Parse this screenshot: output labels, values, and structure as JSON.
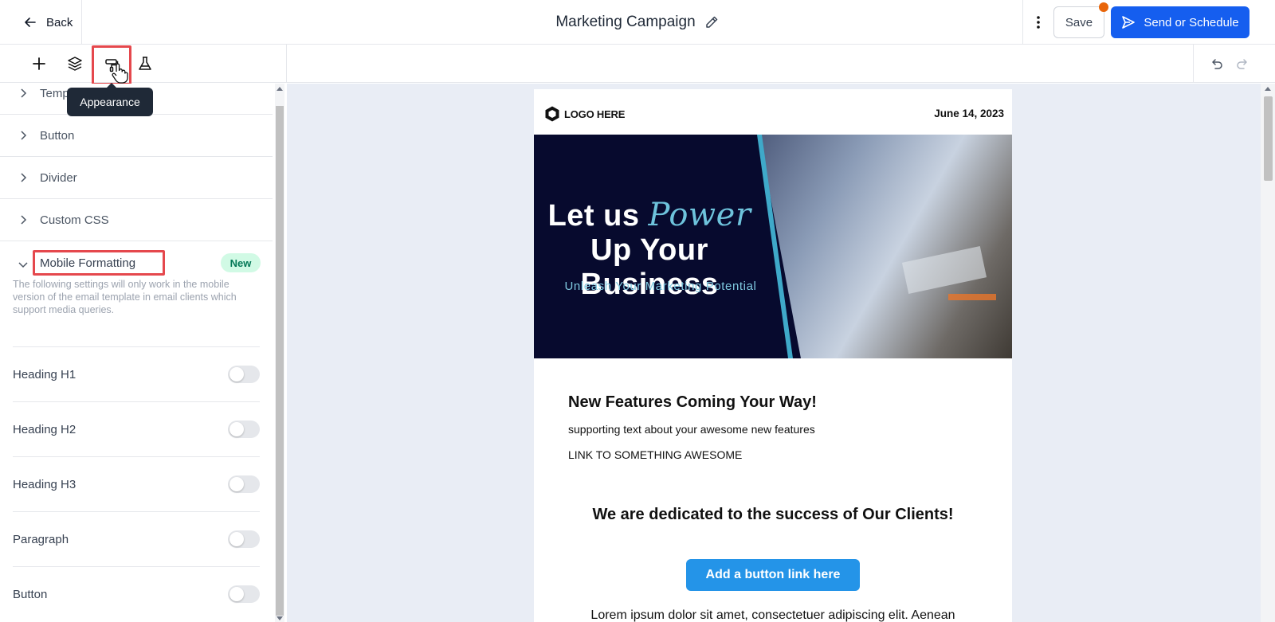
{
  "header": {
    "back_label": "Back",
    "title": "Marketing Campaign",
    "save_label": "Save",
    "send_label": "Send or Schedule",
    "colors": {
      "primary": "#155eef",
      "notification_dot": "#e8650a",
      "highlight": "#e5484d"
    }
  },
  "toolbar": {
    "tools": [
      "add-icon",
      "layers-icon",
      "appearance-icon",
      "flask-icon"
    ],
    "tooltip": "Appearance"
  },
  "panel": {
    "sections": [
      {
        "label": "Temp"
      },
      {
        "label": "Button"
      },
      {
        "label": "Divider"
      },
      {
        "label": "Custom CSS"
      }
    ],
    "mobile": {
      "label": "Mobile Formatting",
      "badge": "New",
      "description": "The following settings will only work in the mobile version of the email template in email clients which support media queries."
    },
    "settings": [
      {
        "label": "Heading H1",
        "enabled": false
      },
      {
        "label": "Heading H2",
        "enabled": false
      },
      {
        "label": "Heading H3",
        "enabled": false
      },
      {
        "label": "Paragraph",
        "enabled": false
      },
      {
        "label": "Button",
        "enabled": false
      }
    ]
  },
  "email": {
    "logo": "LOGO HERE",
    "date": "June 14, 2023",
    "hero": {
      "line1": "Let us",
      "accent": "Power",
      "line2": "Up Your Business",
      "subtitle": "Unleash Your Marketing Potential"
    },
    "feature_title": "New Features Coming Your Way!",
    "feature_text": "supporting text about your awesome new features",
    "feature_link": "LINK TO SOMETHING AWESOME",
    "dedicated": "We are dedicated to the success of Our Clients!",
    "cta": "Add a button link here",
    "lorem": "Lorem ipsum dolor sit amet, consectetuer adipiscing elit. Aenean"
  }
}
